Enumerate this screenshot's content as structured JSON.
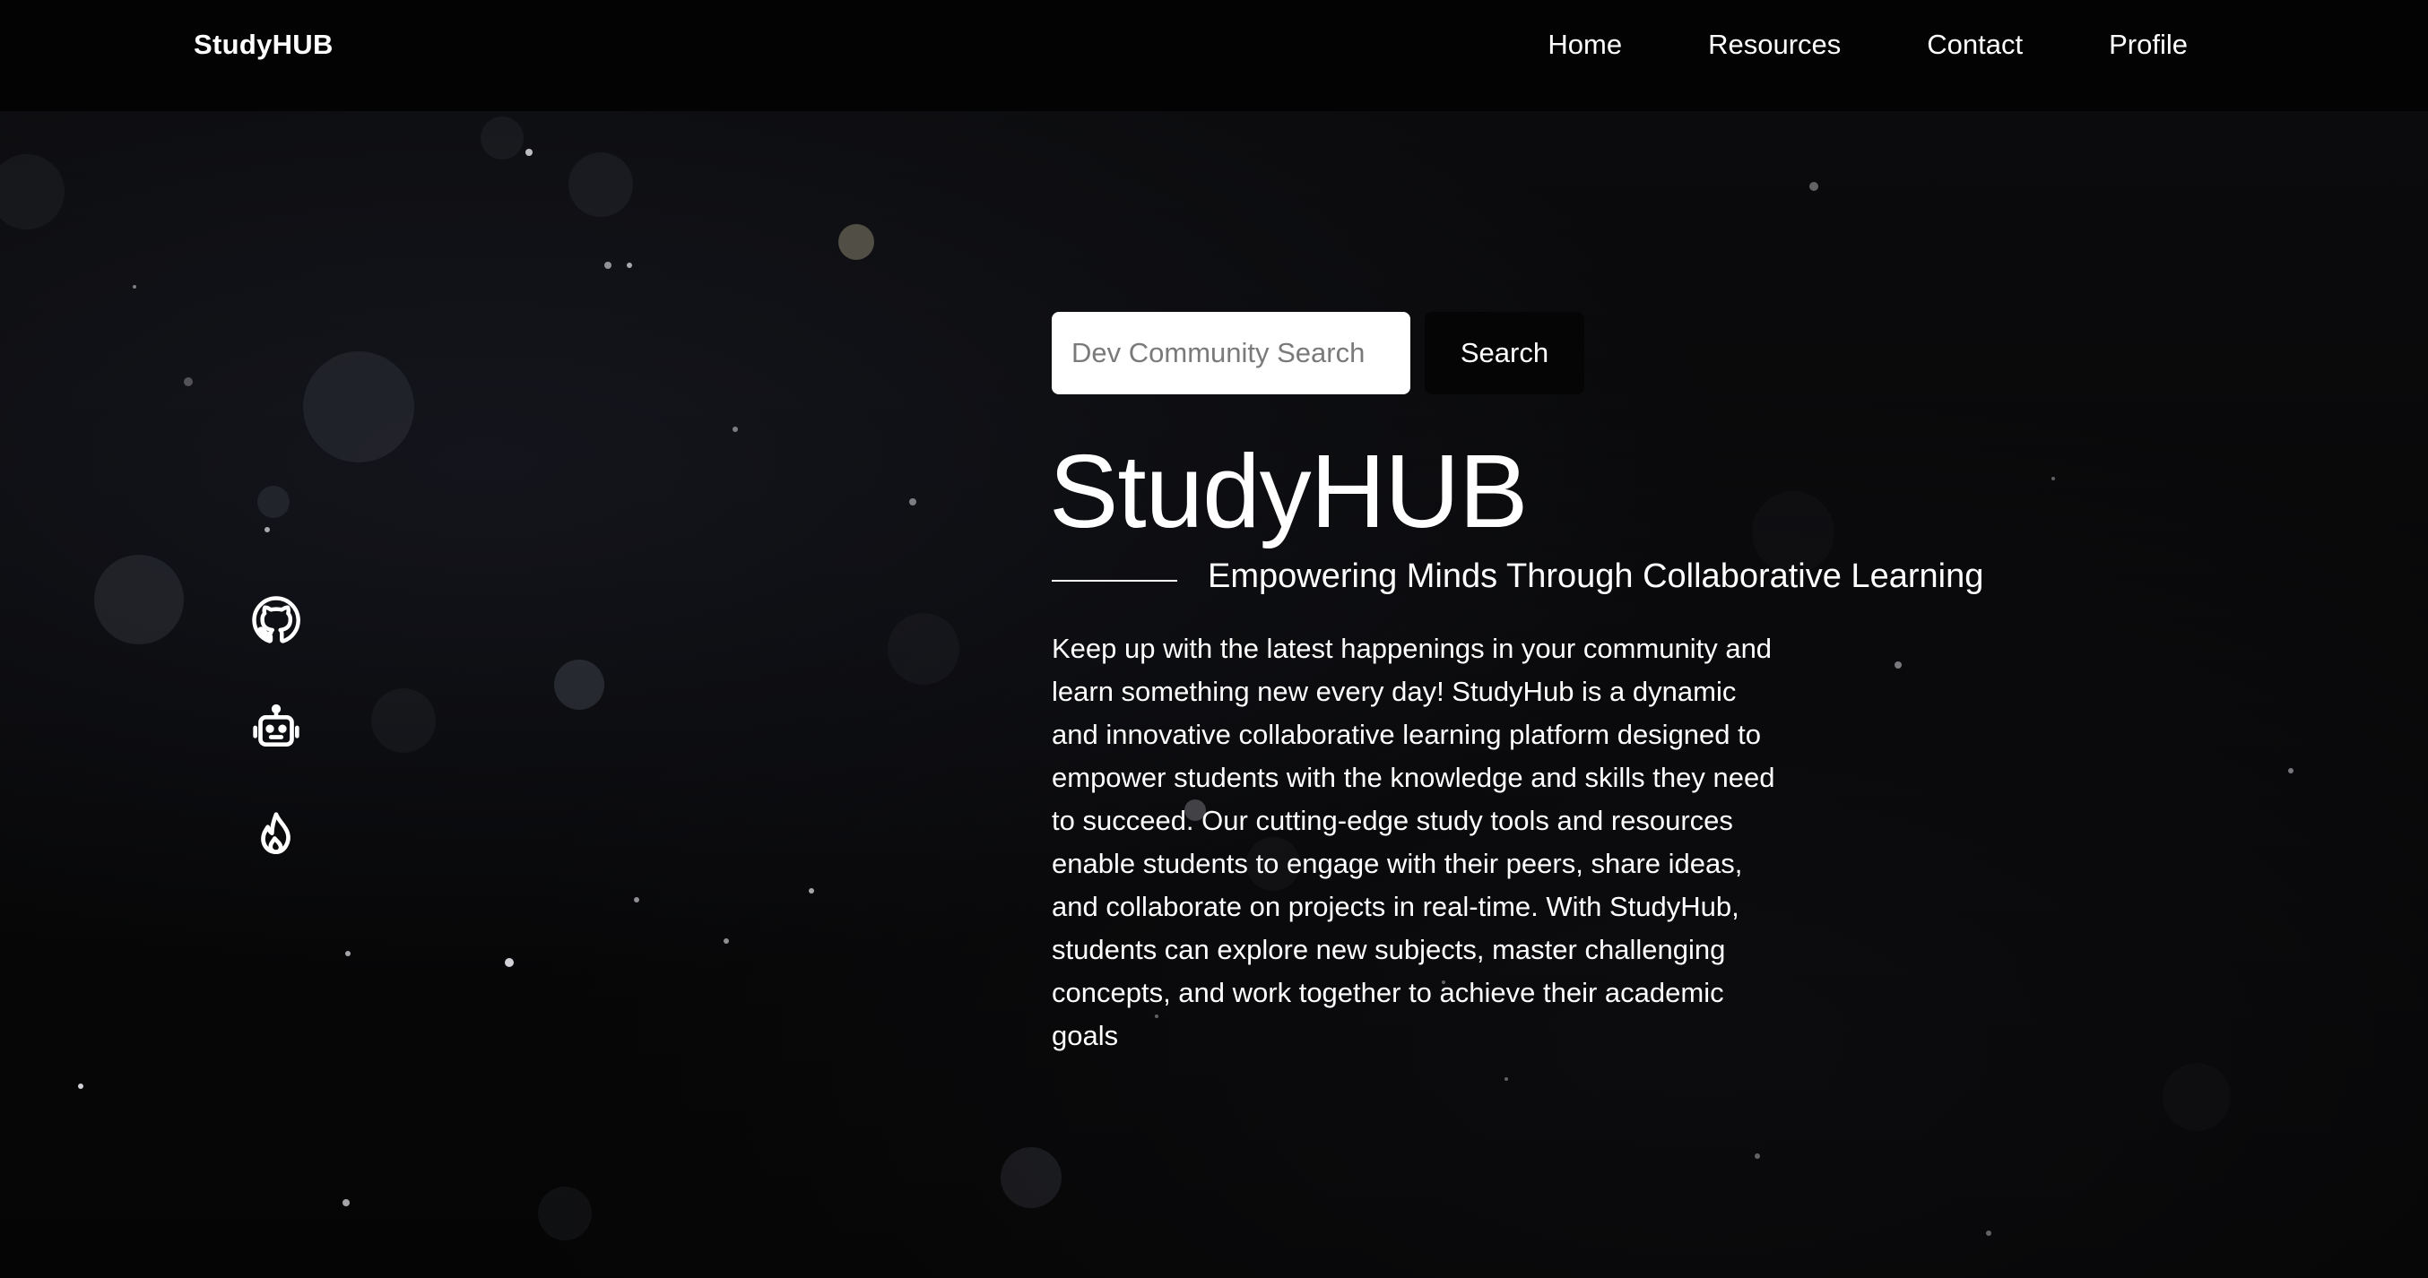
{
  "navbar": {
    "brand": "StudyHUB",
    "links": [
      "Home",
      "Resources",
      "Contact",
      "Profile"
    ]
  },
  "social": [
    {
      "icon": "github-icon"
    },
    {
      "icon": "robot-icon"
    },
    {
      "icon": "fire-icon"
    }
  ],
  "search": {
    "placeholder": "Dev Community Search",
    "button_label": "Search"
  },
  "hero": {
    "title": "StudyHUB",
    "subtitle": "Empowering Minds Through Collaborative Learning",
    "description": "Keep up with the latest happenings in your community and learn something new every day! StudyHub is a dynamic and innovative collaborative learning platform designed to empower students with the knowledge and skills they need to succeed. Our cutting-edge study tools and resources enable students to engage with their peers, share ideas, and collaborate on projects in real-time. With StudyHub, students can explore new subjects, master challenging concepts, and work together to achieve their academic goals"
  },
  "colors": {
    "background": "#000000",
    "navbar": "#030303",
    "text": "#ffffff",
    "input_bg": "#ffffff"
  }
}
